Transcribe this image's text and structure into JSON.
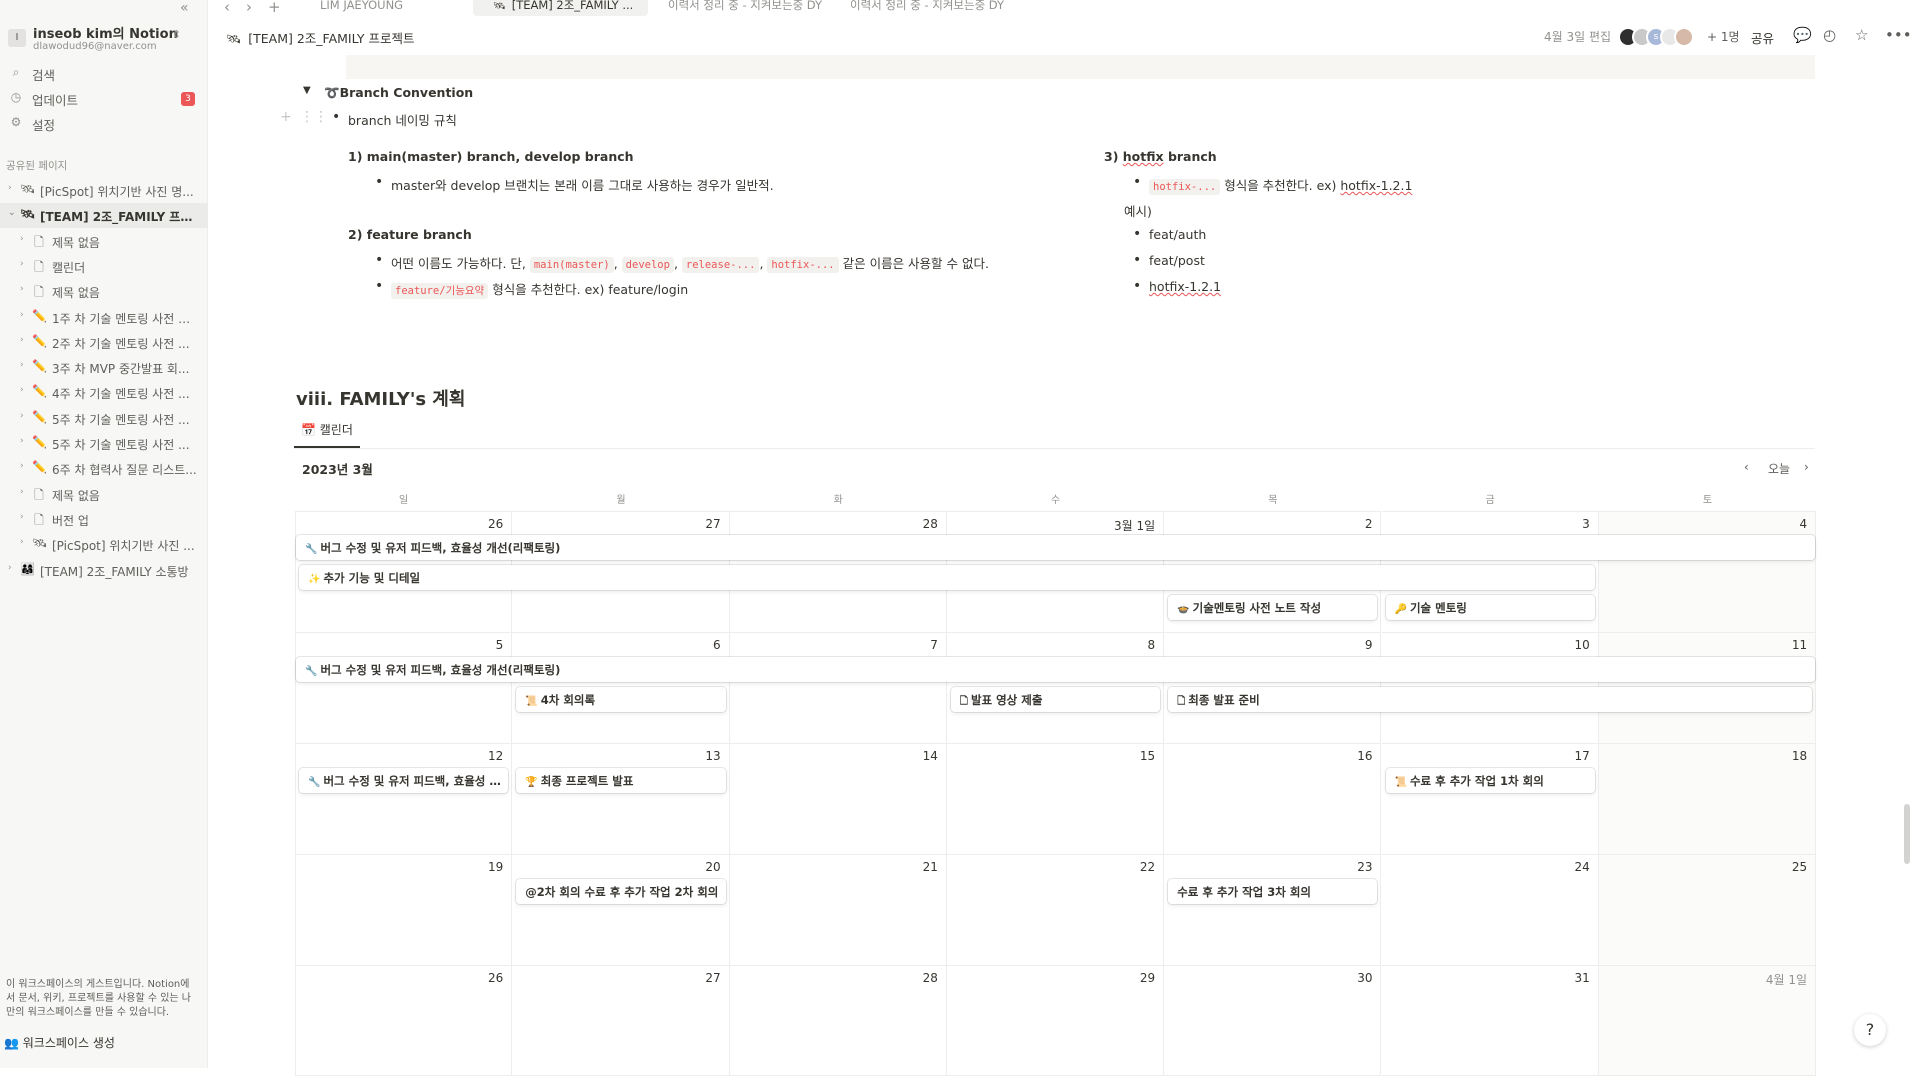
{
  "window": {
    "title": "[TEAM] 2조_FAMILY 프로젝트"
  },
  "tabs": [
    {
      "label": "LIM JAEYOUNG"
    },
    {
      "label": "[TEAM] 2조_FAMILY ..."
    },
    {
      "label": "이력서 정리 중 - 지켜보는중 DY"
    },
    {
      "label": "이력서 정리 중 - 지켜보는중 DY"
    }
  ],
  "sidebar": {
    "workspace_badge": "I",
    "workspace_name": "inseob kim의 Notion",
    "workspace_email": "dlawodud96@naver.com",
    "nav": [
      {
        "icon": "search-icon",
        "label": "검색"
      },
      {
        "icon": "clock-icon",
        "label": "업데이트",
        "badge": "3"
      },
      {
        "icon": "gear-icon",
        "label": "설정"
      }
    ],
    "section_label": "공유된 페이지",
    "tree": [
      {
        "label": "[PicSpot] 위치기반 사진 명...",
        "icon": "project-icon",
        "level": 0,
        "active": false,
        "open": false
      },
      {
        "label": "[TEAM] 2조_FAMILY 프로...",
        "icon": "project-icon",
        "level": 0,
        "active": true,
        "open": true
      },
      {
        "label": "제목 없음",
        "icon": "page-icon",
        "level": 1
      },
      {
        "label": "캘린더",
        "icon": "page-icon",
        "level": 1
      },
      {
        "label": "제목 없음",
        "icon": "page-icon",
        "level": 1
      },
      {
        "label": "1주 차 기술 멘토링 사전 노...",
        "icon": "pencil-icon",
        "level": 1
      },
      {
        "label": "2주 차 기술 멘토링 사전 ...",
        "icon": "pencil-icon",
        "level": 1
      },
      {
        "label": "3주 차 MVP 중간발표 회...",
        "icon": "pencil-icon",
        "level": 1
      },
      {
        "label": "4주 차 기술 멘토링 사전 ...",
        "icon": "pencil-icon",
        "level": 1
      },
      {
        "label": "5주 차 기술 멘토링 사전 ...",
        "icon": "pencil-icon",
        "level": 1
      },
      {
        "label": "5주 차 기술 멘토링 사전 ...",
        "icon": "pencil-icon",
        "level": 1
      },
      {
        "label": "6주 차 협력사 질문 리스트...",
        "icon": "pencil-icon",
        "level": 1
      },
      {
        "label": "제목 없음",
        "icon": "page-icon",
        "level": 1
      },
      {
        "label": "버전 업",
        "icon": "page-icon",
        "level": 1
      },
      {
        "label": "[PicSpot] 위치기반 사진 ...",
        "icon": "project-icon",
        "level": 1
      },
      {
        "label": "[TEAM] 2조_FAMILY 소통방",
        "icon": "people-icon",
        "level": 0
      }
    ],
    "guest_note": "이 워크스페이스의 게스트입니다. Notion에서 문서, 위키, 프로젝트를 사용할 수 있는 나만의 워크스페이스를 만들 수 있습니다.",
    "create_workspace": "워크스페이스 생성"
  },
  "topbar": {
    "breadcrumb": "[TEAM] 2조_FAMILY 프로젝트",
    "edited": "4월 3일 편집",
    "extra_users": "+ 1명",
    "share": "공유"
  },
  "doc": {
    "toggle_title": "Branch Convention",
    "bullet_naming": "branch 네이밍 규칙",
    "sec1_title": "1) main(master) branch, develop branch",
    "sec1_item": "master와 develop 브랜치는 본래 이름 그대로 사용하는 경우가 일반적.",
    "sec2_title": "2) feature branch",
    "sec2_item1_pre": "어떤 이름도 가능하다. 단,",
    "sec2_codes": [
      "main(master)",
      "develop",
      "release-...",
      "hotfix-..."
    ],
    "sec2_item1_post": "같은 이름은 사용할 수 없다.",
    "sec2_item2_code": "feature/기능요약",
    "sec2_item2_post": "형식을 추천한다. ex) feature/login",
    "sec3_title_pre": "3)",
    "sec3_title_word": "hotfix",
    "sec3_title_post": "branch",
    "sec3_item_code": "hotfix-...",
    "sec3_item_mid": "형식을 추천한다. ex)",
    "sec3_item_ex": "hotfix-1.2.1",
    "example_label": "예시)",
    "examples": [
      "feat/auth",
      "feat/post",
      "hotfix-1.2.1"
    ],
    "heading": "viii. FAMILY's 계획"
  },
  "calendar": {
    "view_tab": "캘린더",
    "month": "2023년 3월",
    "today": "오늘",
    "weekdays": [
      "일",
      "월",
      "화",
      "수",
      "목",
      "금",
      "토"
    ],
    "weeks": [
      [
        "26",
        "27",
        "28",
        "3월 1일",
        "2",
        "3",
        "4"
      ],
      [
        "5",
        "6",
        "7",
        "8",
        "9",
        "10",
        "11"
      ],
      [
        "12",
        "13",
        "14",
        "15",
        "16",
        "17",
        "18"
      ],
      [
        "19",
        "20",
        "21",
        "22",
        "23",
        "24",
        "25"
      ],
      [
        "26",
        "27",
        "28",
        "29",
        "30",
        "31",
        "4월 1일"
      ]
    ],
    "events": [
      {
        "title": "버그 수정 및 유저 피드백, 효율성 개선(리팩토링)",
        "icon": "wrench-icon",
        "week": 0,
        "start": 0,
        "end": 7,
        "slot": 0
      },
      {
        "title": "추가 기능 및 디테일",
        "icon": "sparkle-icon",
        "week": 0,
        "start": 0,
        "end": 6,
        "slot": 1
      },
      {
        "title": "기술멘토링 사전 노트 작성",
        "icon": "pot-icon",
        "week": 0,
        "start": 4,
        "end": 5,
        "slot": 2
      },
      {
        "title": "기술 멘토링",
        "icon": "key-icon",
        "week": 0,
        "start": 5,
        "end": 6,
        "slot": 2
      },
      {
        "title": "버그 수정 및 유저 피드백, 효율성 개선(리팩토링)",
        "icon": "wrench-icon",
        "week": 1,
        "start": 0,
        "end": 7,
        "slot": 0
      },
      {
        "title": "4차 회의록",
        "icon": "memo-icon",
        "week": 1,
        "start": 1,
        "end": 2,
        "slot": 1
      },
      {
        "title": "발표 영상 제출",
        "icon": "page-icon",
        "week": 1,
        "start": 3,
        "end": 4,
        "slot": 1
      },
      {
        "title": "최종 발표 준비",
        "icon": "page-icon",
        "week": 1,
        "start": 4,
        "end": 7,
        "slot": 1
      },
      {
        "title": "버그 수정 및 유저 피드백, 효율성 개선(리팩토링)",
        "icon": "wrench-icon",
        "week": 2,
        "start": 0,
        "end": 1,
        "slot": 0
      },
      {
        "title": "최종 프로젝트 발표",
        "icon": "trophy-icon",
        "week": 2,
        "start": 1,
        "end": 2,
        "slot": 0
      },
      {
        "title": "수료 후 추가 작업 1차 회의",
        "icon": "memo-icon",
        "week": 2,
        "start": 5,
        "end": 6,
        "slot": 0
      },
      {
        "title": "@2차 회의 수료 후 추가 작업 2차 회의",
        "icon": "",
        "week": 3,
        "start": 1,
        "end": 2,
        "slot": 0
      },
      {
        "title": "수료 후 추가 작업 3차 회의",
        "icon": "",
        "week": 3,
        "start": 4,
        "end": 5,
        "slot": 0
      }
    ]
  },
  "help": "?",
  "colors": {
    "accent": "#37352f",
    "code_red": "#eb5757",
    "badge_red": "#eb5757",
    "sidebar_bg": "#f7f7f5"
  }
}
